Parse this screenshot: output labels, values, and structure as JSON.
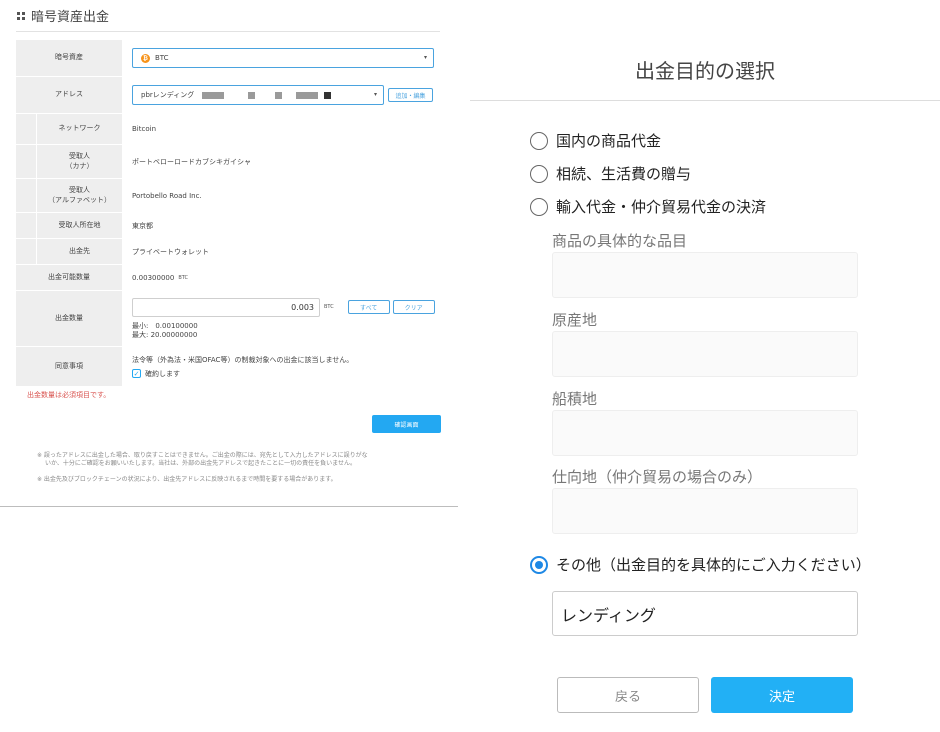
{
  "left": {
    "page_title": "暗号資産出金",
    "rows": {
      "asset_label": "暗号資産",
      "asset_value": "BTC",
      "address_label": "アドレス",
      "address_value": "pbrレンディング",
      "address_add_button": "追加・編集",
      "network_label": "ネットワーク",
      "network_value": "Bitcoin",
      "recipient_kana_label": "受取人\n（カナ）",
      "recipient_kana_value": "ポートベローロードカブシキガイシャ",
      "recipient_alpha_label": "受取人\n（アルファベット）",
      "recipient_alpha_value": "Portobello Road Inc.",
      "recipient_location_label": "受取人所在地",
      "recipient_location_value": "東京都",
      "destination_label": "出金先",
      "destination_value": "プライベートウォレット",
      "available_label": "出金可能数量",
      "available_value": "0.00300000",
      "available_unit": "BTC",
      "amount_label": "出金数量",
      "amount_value": "0.003",
      "amount_unit": "BTC",
      "all_button": "すべて",
      "clear_button": "クリア",
      "min_text": "最小:　0.00100000",
      "max_text": "最大: 20.00000000",
      "consent_label": "同意事項",
      "consent_text": "法令等（外為法・米国OFAC等）の制裁対象への出金に該当しません。",
      "consent_check_label": "確約します"
    },
    "error_text": "出金数量は必須項目です。",
    "confirm_button": "確認画面",
    "note1_line1": "※ 誤ったアドレスに出金した場合、取り戻すことはできません。ご出金の際には、宛先として入力したアドレスに誤りがな",
    "note1_line2": "いか、十分にご確認をお願いいたします。当社は、外部の出金先アドレスで起きたことに一切の責任を負いません。",
    "note2": "※ 出金先及びブロックチェーンの状況により、出金先アドレスに反映されるまで時間を要する場合があります。"
  },
  "right": {
    "title": "出金目的の選択",
    "option1": "国内の商品代金",
    "option2": "相続、生活費の贈与",
    "option3": "輸入代金・仲介貿易代金の決済",
    "field_item": "商品の具体的な品目",
    "field_origin": "原産地",
    "field_shipping": "船積地",
    "field_destination": "仕向地（仲介貿易の場合のみ）",
    "option_other": "その他（出金目的を具体的にご入力ください）",
    "other_value": "レンディング",
    "back_button": "戻る",
    "ok_button": "決定"
  },
  "colors": {
    "accent": "#23a8f2",
    "radio_selected": "#1e88e5",
    "error": "#d9534f",
    "label_bg": "#eeeeee",
    "btc": "#f7931a"
  },
  "icons": [
    "grid-icon",
    "btc-icon",
    "chevron-down-icon",
    "checkbox-checked-icon",
    "radio-icon"
  ]
}
